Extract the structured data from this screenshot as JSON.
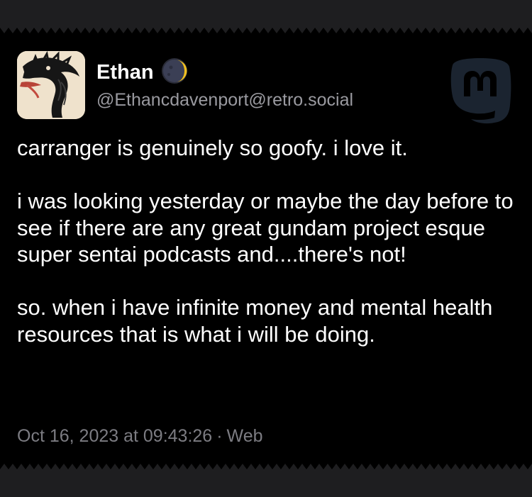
{
  "post": {
    "author": {
      "display_name": "Ethan",
      "handle": "@Ethancdavenport@retro.social",
      "avatar": "dragon-illustration-avatar",
      "badge_icon": "crescent-moon-icon"
    },
    "platform_icon": "mastodon-logo-icon",
    "paragraphs": [
      "carranger is genuinely so goofy. i love it.",
      "i was looking yesterday or maybe the day before to see if there are any great gundam project esque super sentai podcasts and....there's not!",
      "so. when i have infinite money and mental health resources that is what i will be doing."
    ],
    "timestamp": "Oct 16, 2023 at 09:43:26",
    "separator": "·",
    "source": "Web"
  },
  "colors": {
    "card_background": "#000000",
    "page_background": "#1e1e20",
    "text_primary": "#ffffff",
    "text_secondary": "#9a9aa0",
    "logo": "#1b2430"
  }
}
